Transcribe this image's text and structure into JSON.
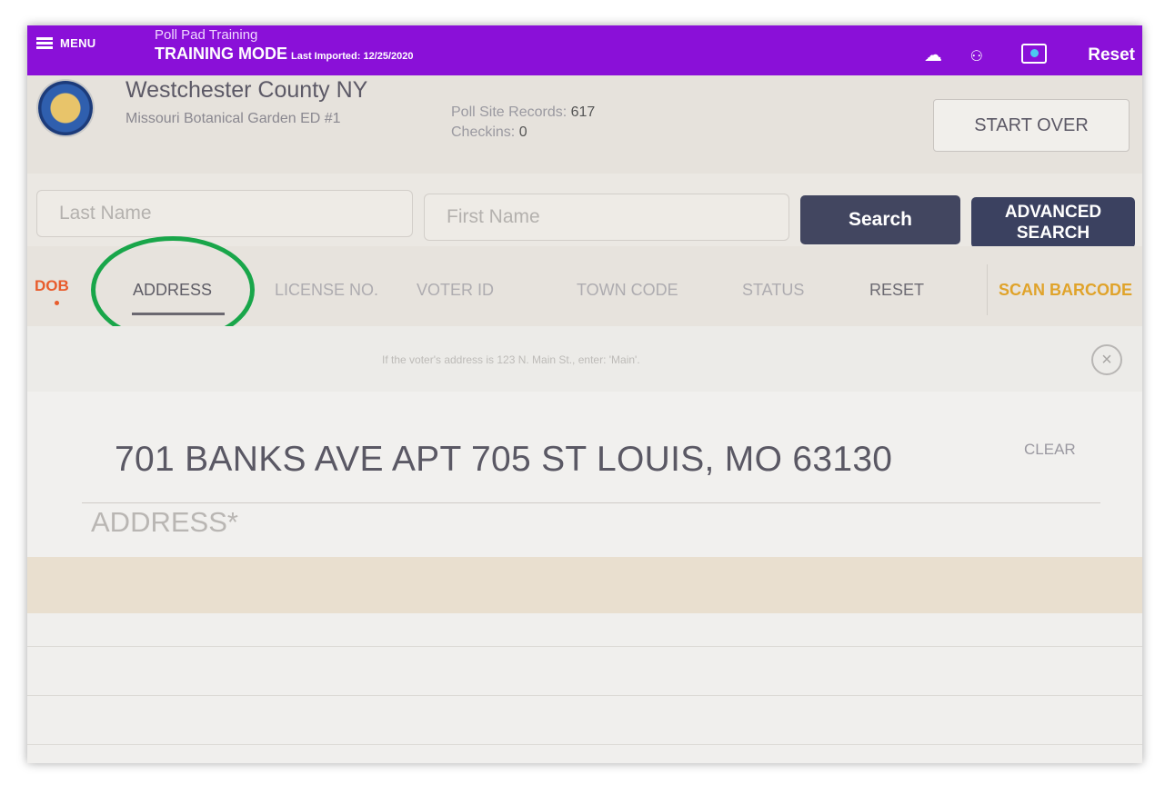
{
  "topbar": {
    "menu_label": "MENU",
    "app_name": "Poll Pad Training",
    "mode_label": "TRAINING MODE",
    "last_imported": "Last Imported: 12/25/2020",
    "reset_label": "Reset",
    "background_color": "#8a10d8"
  },
  "header": {
    "county_name": "Westchester County NY",
    "site_name": "Missouri Botanical Garden ED #1",
    "records_label": "Poll Site Records:",
    "records_value": "617",
    "checkins_label": "Checkins:",
    "checkins_value": "0",
    "start_over_label": "START OVER"
  },
  "search": {
    "last_name_placeholder": "Last Name",
    "first_name_placeholder": "First Name",
    "search_label": "Search",
    "advanced_line1": "ADVANCED",
    "advanced_line2": "SEARCH",
    "button_color": "#424660"
  },
  "tabs": {
    "dob": "DOB",
    "address": "ADDRESS",
    "license": "LICENSE NO.",
    "voter_id": "VOTER ID",
    "town_code": "TOWN CODE",
    "status": "STATUS",
    "reset": "RESET",
    "scan_barcode": "SCAN BARCODE",
    "active_tab": "ADDRESS",
    "highlight_color": "#19a64a"
  },
  "hint": {
    "text": "If the voter's address is 123 N. Main St., enter: 'Main'."
  },
  "address_entry": {
    "value": "701 BANKS AVE APT 705 ST LOUIS, MO 63130",
    "clear_label": "CLEAR",
    "field_label": "ADDRESS*"
  }
}
